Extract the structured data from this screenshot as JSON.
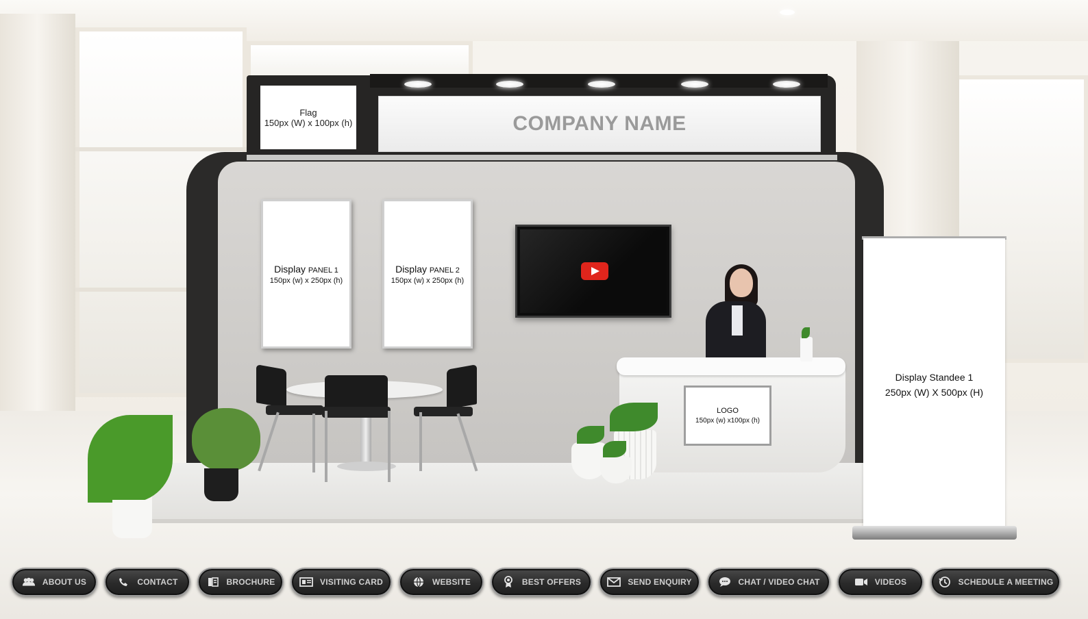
{
  "booth": {
    "flag_line1": "Flag",
    "flag_line2": "150px (W) x 100px (h)",
    "company_name": "COMPANY NAME",
    "panel1_line1_a": "Display",
    "panel1_line1_b": "PANEL 1",
    "panel1_line2": "150px (w) x 250px (h)",
    "panel2_line1_a": "Display",
    "panel2_line1_b": "PANEL 2",
    "panel2_line2": "150px (w) x 250px (h)",
    "logo_line1": "LOGO",
    "logo_line2": "150px (w) x100px (h)",
    "standee_line1": "Display Standee 1",
    "standee_line2": "250px (W) X 500px (H)"
  },
  "toolbar": {
    "buttons": [
      {
        "label": "ABOUT US",
        "icon": "people-icon"
      },
      {
        "label": "CONTACT",
        "icon": "phone-icon"
      },
      {
        "label": "BROCHURE",
        "icon": "brochure-icon"
      },
      {
        "label": "VISITING CARD",
        "icon": "id-card-icon"
      },
      {
        "label": "WEBSITE",
        "icon": "globe-icon"
      },
      {
        "label": "BEST OFFERS",
        "icon": "award-icon"
      },
      {
        "label": "SEND ENQUIRY",
        "icon": "mail-icon"
      },
      {
        "label": "CHAT / VIDEO CHAT",
        "icon": "chat-icon"
      },
      {
        "label": "VIDEOS",
        "icon": "video-camera-icon"
      },
      {
        "label": "SCHEDULE A MEETING",
        "icon": "clock-icon"
      }
    ]
  },
  "colors": {
    "booth_dark": "#2b2a29",
    "toolbar_button": "#2a2a2a",
    "play_button": "#e0251c"
  }
}
